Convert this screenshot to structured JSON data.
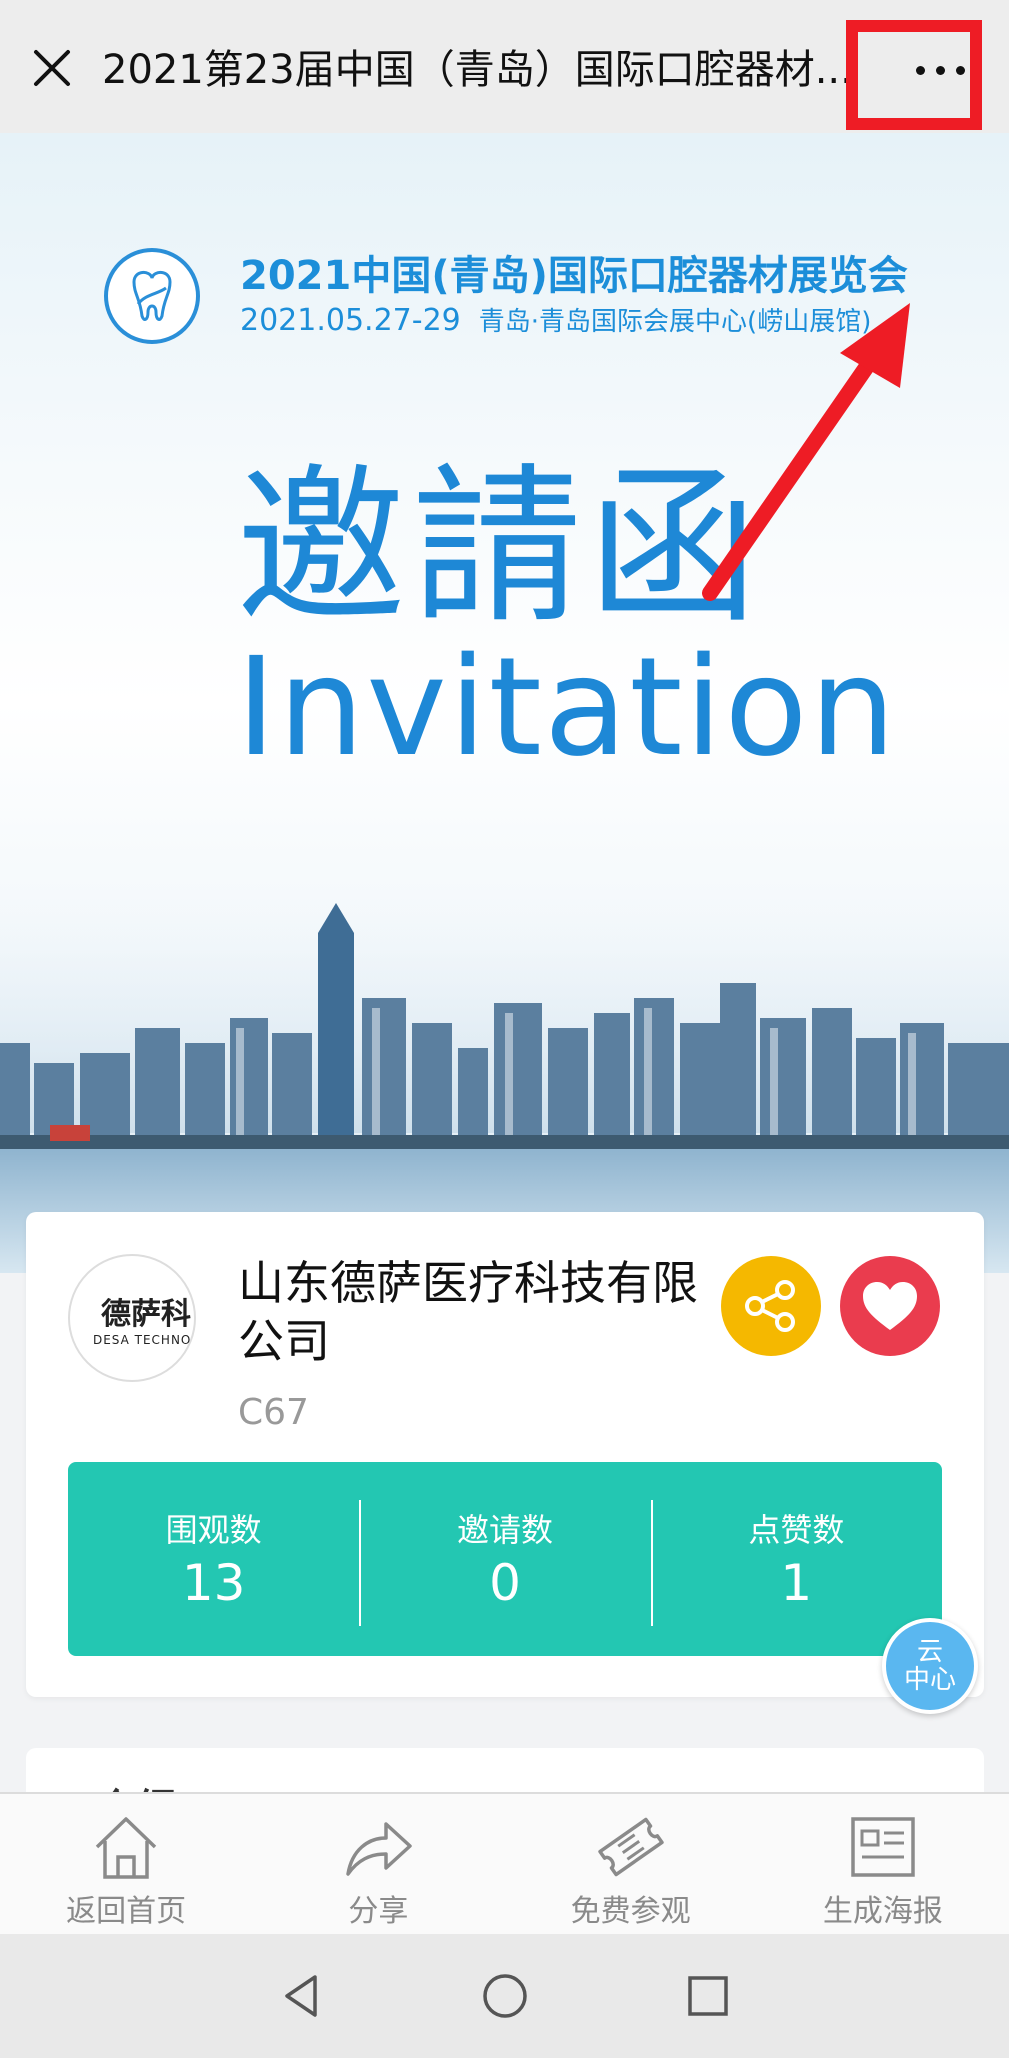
{
  "titlebar": {
    "title": "2021第23届中国（青岛）国际口腔器材..."
  },
  "hero": {
    "expo_title": "2021中国(青岛)国际口腔器材展览会",
    "expo_date": "2021.05.27-29",
    "expo_venue": "青岛·青岛国际会展中心(崂山展馆)",
    "invite_cn": "邀請函",
    "invite_en": "Invitation"
  },
  "company": {
    "avatar_cn": "德萨科",
    "avatar_en": "DESA TECHNOL",
    "name": "山东德萨医疗科技有限公司",
    "booth": "C67"
  },
  "stats": [
    {
      "label": "围观数",
      "value": "13"
    },
    {
      "label": "邀请数",
      "value": "0"
    },
    {
      "label": "点赞数",
      "value": "1"
    }
  ],
  "cloud_badge": {
    "line1": "云",
    "line2": "中心"
  },
  "section2": {
    "title": "介绍"
  },
  "tabbar": {
    "items": [
      {
        "label": "返回首页",
        "icon": "home-icon"
      },
      {
        "label": "分享",
        "icon": "share-arrow-icon"
      },
      {
        "label": "免费参观",
        "icon": "ticket-icon"
      },
      {
        "label": "生成海报",
        "icon": "poster-icon"
      }
    ]
  },
  "colors": {
    "accent_blue": "#1e88d6",
    "stats_bg": "#23c7b2",
    "share_bg": "#f5b800",
    "like_bg": "#ea3c4e",
    "annotation_red": "#ee1c25"
  }
}
